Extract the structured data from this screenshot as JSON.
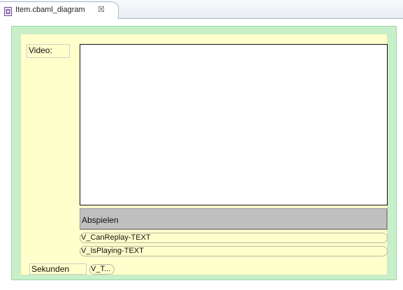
{
  "editor": {
    "tab_title": "Item.cbaml_diagram",
    "tab_icon": "diagram-file-icon",
    "close_glyph": "☒"
  },
  "form": {
    "video_label": "Video:",
    "play_button_label": "Abspielen",
    "can_replay_field": "V_CanReplay-TEXT",
    "is_playing_field": "V_IsPlaying-TEXT",
    "seconds_label": "Sekunden",
    "seconds_field": "V_T..."
  },
  "colors": {
    "outer_frame": "#c7efc9",
    "inner_panel": "#ffffcc",
    "button_gray": "#c0c0c0"
  }
}
